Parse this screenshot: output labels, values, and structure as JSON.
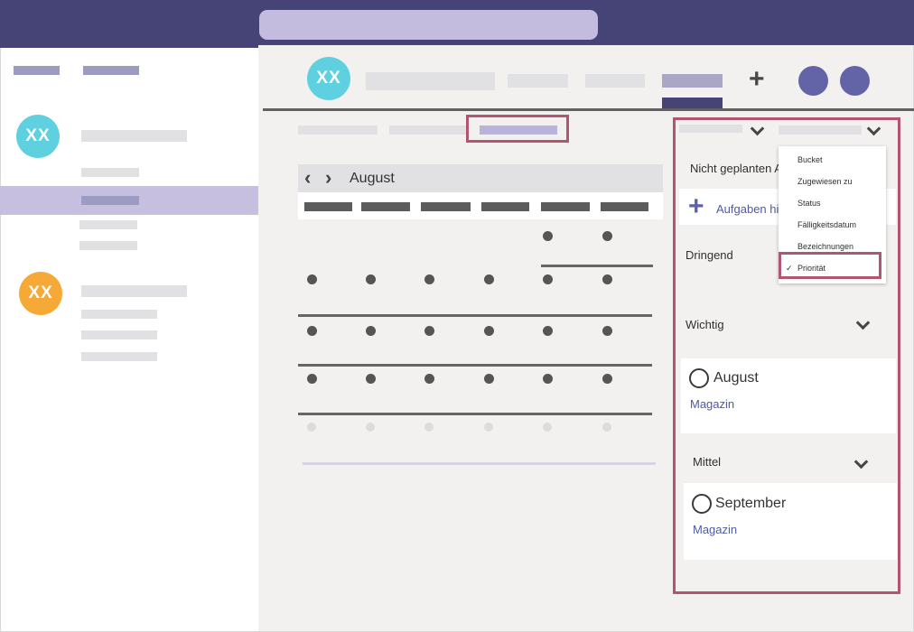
{
  "calendar": {
    "month": "August",
    "prev_glyph": "‹",
    "next_glyph": "›"
  },
  "avatars": {
    "header": "XX",
    "list_1": "XX",
    "list_2": "XX"
  },
  "header": {
    "add_glyph": "+"
  },
  "right_panel": {
    "unscheduled_label": "Nicht geplanten A",
    "add_tasks_label": "Aufgaben hi",
    "add_glyph": "+",
    "groups": [
      {
        "label": "Dringend"
      },
      {
        "label": "Wichtig",
        "task": {
          "title": "August",
          "bucket": "Magazin"
        }
      },
      {
        "label": "Mittel",
        "task": {
          "title": "September",
          "bucket": "Magazin"
        }
      }
    ]
  },
  "dropdown": {
    "items": [
      "Bucket",
      "Zugewiesen zu",
      "Status",
      "Fälligkeitsdatum",
      "Bezeichnungen",
      "Priorität"
    ],
    "selected_index": 5,
    "check_glyph": "✓"
  },
  "colors": {
    "topbar": "#464476",
    "search": "#c3bcde",
    "accent": "#6264a7",
    "highlight": "#b05670",
    "avatar_teal": "#5fd0df",
    "avatar_orange": "#f6a937",
    "selection": "#c6bfe0"
  }
}
